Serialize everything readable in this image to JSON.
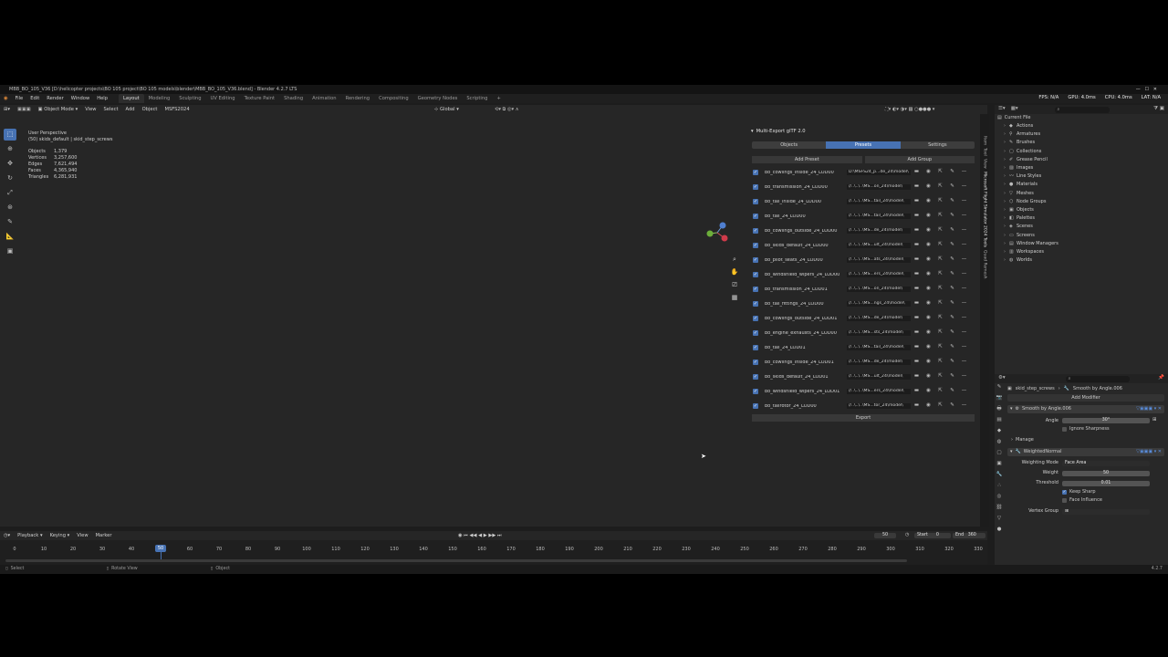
{
  "titlebar": {
    "text": "MBB_BO_105_V36 [D:\\helicopter projects\\BO 105 project\\BO 105 models\\blender\\MBB_BO_105_V36.blend] - Blender 4.2.7 LTS"
  },
  "top_right": {
    "fps": "FPS: N/A",
    "gpu": "GPU: 4.0ms",
    "cpu": "CPU: 4.0ms",
    "lat": "LAT: N/A"
  },
  "menu": [
    "File",
    "Edit",
    "Render",
    "Window",
    "Help"
  ],
  "workspaces": [
    "Layout",
    "Modeling",
    "Sculpting",
    "UV Editing",
    "Texture Paint",
    "Shading",
    "Animation",
    "Rendering",
    "Compositing",
    "Geometry Nodes",
    "Scripting"
  ],
  "viewport_header": {
    "mode": "Object Mode",
    "items": [
      "View",
      "Select",
      "Add",
      "Object",
      "MSFS2024"
    ],
    "orientation": "Global",
    "options": "Options"
  },
  "viewport_info": {
    "perspective": "User Perspective",
    "collection": "(50) skids_default | skid_step_screws",
    "stats": [
      {
        "label": "Objects",
        "value": "1,379"
      },
      {
        "label": "Vertices",
        "value": "3,257,600"
      },
      {
        "label": "Edges",
        "value": "7,621,494"
      },
      {
        "label": "Faces",
        "value": "4,365,940"
      },
      {
        "label": "Triangles",
        "value": "6,281,931"
      }
    ]
  },
  "tools": [
    "select-box",
    "cursor",
    "move",
    "rotate",
    "scale",
    "transform",
    "annotate",
    "measure",
    "add-cube"
  ],
  "export_panel": {
    "title": "Multi-Export glTF 2.0",
    "tabs": [
      "Objects",
      "Presets",
      "Settings"
    ],
    "active_tab": "Presets",
    "add_preset": "Add Preset",
    "add_group": "Add Group",
    "export": "Export",
    "rows": [
      {
        "name": "bo_cowlings_inside_24_LOD00",
        "path": "D:\\MSFS24_p...de_24\\model\\"
      },
      {
        "name": "bo_transmission_24_LOD00",
        "path": "//..\\..\\..\\MS...on_24\\model\\"
      },
      {
        "name": "bo_tail_inside_24_LOD00",
        "path": "//..\\..\\..\\MS...tail_24\\model\\"
      },
      {
        "name": "bo_tail_24_LOD00",
        "path": "//..\\..\\..\\MS...tail_24\\model\\"
      },
      {
        "name": "bo_cowlings_outside_24_LOD00",
        "path": "//..\\..\\..\\MS...de_24\\model\\"
      },
      {
        "name": "bo_skids_default_24_LOD00",
        "path": "//..\\..\\..\\MS...ult_24\\model\\"
      },
      {
        "name": "bo_pilot_seats_24_LOD00",
        "path": "//..\\..\\..\\MS...ats_24\\model\\"
      },
      {
        "name": "bo_windshield_wipers_24_LOD00",
        "path": "//..\\..\\..\\MS...ers_24\\model\\"
      },
      {
        "name": "bo_transmission_24_LOD01",
        "path": "//..\\..\\..\\MS...on_24\\model\\"
      },
      {
        "name": "bo_tail_fittings_24_LOD00",
        "path": "//..\\..\\..\\MS...ngs_24\\model\\"
      },
      {
        "name": "bo_cowlings_outside_24_LOD01",
        "path": "//..\\..\\..\\MS...de_24\\model\\"
      },
      {
        "name": "bo_engine_exhausts_24_LOD00",
        "path": "//..\\..\\..\\MS...sts_24\\model\\"
      },
      {
        "name": "bo_tail_24_LOD01",
        "path": "//..\\..\\..\\MS...tail_24\\model\\"
      },
      {
        "name": "bo_cowlings_inside_24_LOD01",
        "path": "//..\\..\\..\\MS...de_24\\model\\"
      },
      {
        "name": "bo_skids_default_24_LOD01",
        "path": "//..\\..\\..\\MS...ult_24\\model\\"
      },
      {
        "name": "bo_windshield_wipers_24_LOD01",
        "path": "//..\\..\\..\\MS...ers_24\\model\\"
      },
      {
        "name": "bo_tailrotor_24_LOD00",
        "path": "//..\\..\\..\\MS...tor_24\\model\\"
      }
    ]
  },
  "sidebar_tabs": [
    "Item",
    "Tool",
    "View",
    "Microsoft Flight Simulator 2024 Tools",
    "Quad Remesh"
  ],
  "outliner": {
    "title": "Current File",
    "items": [
      "Actions",
      "Armatures",
      "Brushes",
      "Collections",
      "Grease Pencil",
      "Images",
      "Line Styles",
      "Materials",
      "Meshes",
      "Node Groups",
      "Objects",
      "Palettes",
      "Scenes",
      "Screens",
      "Window Managers",
      "Workspaces",
      "Worlds"
    ]
  },
  "properties": {
    "object": "skid_step_screws",
    "modifier_path": "Smooth by Angle.006",
    "add_modifier": "Add Modifier",
    "mod1": {
      "name": "Smooth by Angle.006",
      "angle_label": "Angle",
      "angle": "30°",
      "ignore_sharpness": "Ignore Sharpness",
      "manage": "Manage"
    },
    "mod2": {
      "name": "WeightedNormal",
      "mode_label": "Weighting Mode",
      "mode": "Face Area",
      "weight_label": "Weight",
      "weight": "50",
      "threshold_label": "Threshold",
      "threshold": "0.01",
      "keep_sharp": "Keep Sharp",
      "face_influence": "Face Influence",
      "vgroup_label": "Vertex Group"
    }
  },
  "timeline": {
    "items": [
      "Playback",
      "Keying",
      "View",
      "Marker"
    ],
    "current_frame": "50",
    "start_label": "Start",
    "start": "0",
    "end_label": "End",
    "end": "360",
    "ticks": [
      "0",
      "10",
      "20",
      "30",
      "40",
      "50",
      "60",
      "70",
      "80",
      "90",
      "100",
      "110",
      "120",
      "130",
      "140",
      "150",
      "160",
      "170",
      "180",
      "190",
      "200",
      "210",
      "220",
      "230",
      "240",
      "250",
      "260",
      "270",
      "280",
      "290",
      "300",
      "310",
      "320",
      "330"
    ]
  },
  "statusbar": {
    "select": "Select",
    "rotate": "Rotate View",
    "object": "Object",
    "version": "4.2.7"
  }
}
